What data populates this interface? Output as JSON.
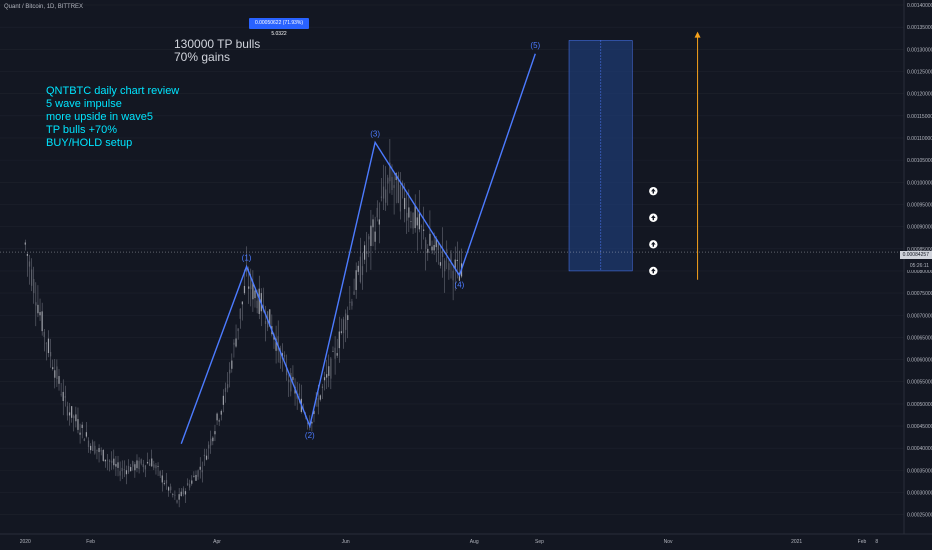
{
  "header": {
    "symbol": "Quant / Bitcoin, 1D, BITTREX"
  },
  "colors": {
    "background": "#131722",
    "wave": "#4c7bff",
    "candles": "#787b86",
    "arrow": "#f7a21b",
    "cyan_text": "#00e5ff",
    "measure": "#1e3a70"
  },
  "annotations": {
    "left_note": "QNTBTC daily chart review\n5 wave impulse\nmore upside in wave5\nTP bulls +70%\nBUY/HOLD setup",
    "top_note": "130000 TP bulls\n70% gains",
    "measure_label": "0.00050622 (71.93%) 5.0322",
    "current_price": "0.00084257",
    "countdown": "05:26:11",
    "up_arrow_icon_count": 4
  },
  "chart_data": {
    "type": "line",
    "title": "",
    "xlabel": "",
    "ylabel": "",
    "x_ticks": [
      "2020",
      "Feb",
      "Apr",
      "Jun",
      "Aug",
      "Sep",
      "Nov",
      "2021",
      "Feb",
      "8"
    ],
    "y_ticks": [
      "0.00140000",
      "0.00135000",
      "0.00130000",
      "0.00125000",
      "0.00120000",
      "0.00115000",
      "0.00110000",
      "0.00105000",
      "0.00100000",
      "0.00095000",
      "0.00090000",
      "0.00085000",
      "0.00080000",
      "0.00075000",
      "0.00070000",
      "0.00065000",
      "0.00060000",
      "0.00055000",
      "0.00050000",
      "0.00045000",
      "0.00040000",
      "0.00035000",
      "0.00030000",
      "0.00025000"
    ],
    "ylim": [
      0.00022,
      0.0014
    ],
    "x_range": [
      "2019-12-20",
      "2021-02-20"
    ],
    "series": [
      {
        "points": [
          {
            "x": "2020-03-15",
            "y": 0.00041,
            "label": ""
          },
          {
            "x": "2020-04-15",
            "y": 0.00081,
            "label": "(1)"
          },
          {
            "x": "2020-05-15",
            "y": 0.00045,
            "label": "(2)"
          },
          {
            "x": "2020-06-15",
            "y": 0.00109,
            "label": "(3)"
          },
          {
            "x": "2020-07-25",
            "y": 0.00079,
            "label": "(4)"
          },
          {
            "x": "2020-08-30",
            "y": 0.00129,
            "label": "(5)"
          }
        ]
      }
    ],
    "price_path": [
      [
        "2020-01-01",
        0.00086
      ],
      [
        "2020-01-10",
        0.00066
      ],
      [
        "2020-01-20",
        0.0005
      ],
      [
        "2020-02-01",
        0.00041
      ],
      [
        "2020-02-15",
        0.00035
      ],
      [
        "2020-03-01",
        0.00037
      ],
      [
        "2020-03-13",
        0.00028
      ],
      [
        "2020-03-25",
        0.00036
      ],
      [
        "2020-04-05",
        0.00052
      ],
      [
        "2020-04-15",
        0.00078
      ],
      [
        "2020-04-25",
        0.0007
      ],
      [
        "2020-05-05",
        0.00056
      ],
      [
        "2020-05-15",
        0.00046
      ],
      [
        "2020-05-25",
        0.00058
      ],
      [
        "2020-06-05",
        0.00076
      ],
      [
        "2020-06-15",
        0.0009
      ],
      [
        "2020-06-22",
        0.00101
      ],
      [
        "2020-07-01",
        0.00094
      ],
      [
        "2020-07-10",
        0.00086
      ],
      [
        "2020-07-20",
        0.00082
      ],
      [
        "2020-07-26",
        0.00079
      ]
    ],
    "measurement": {
      "from": 0.0008,
      "to": 0.00132,
      "change": "71.93%"
    },
    "target_arrow": {
      "x": "2020-11-15",
      "from": 0.00078,
      "to": 0.00134
    }
  }
}
